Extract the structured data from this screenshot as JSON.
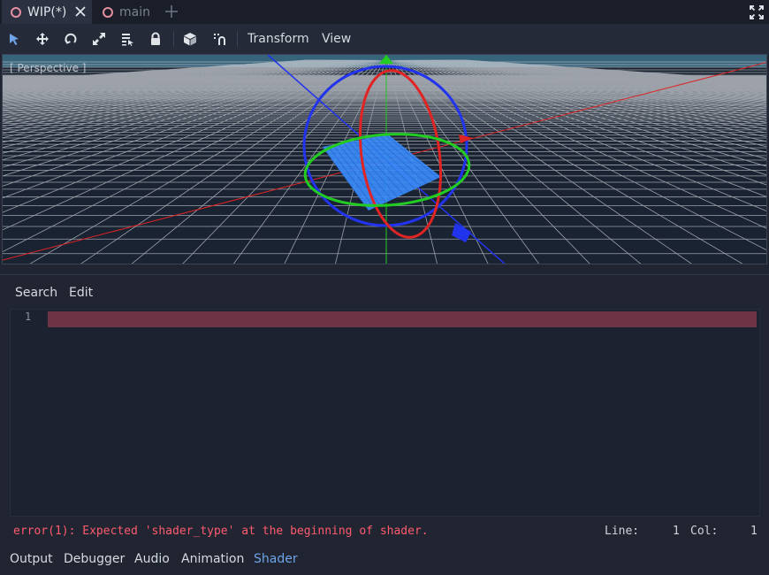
{
  "scene_tabs": {
    "tabs": [
      {
        "label": "WIP(*)",
        "icon": "scene-node-icon",
        "active": true
      },
      {
        "label": "main",
        "icon": "scene-node-icon",
        "active": false
      }
    ],
    "add_icon": "plus-icon",
    "close_icon": "close-icon",
    "distraction_icon": "fullscreen-icon"
  },
  "toolbar": {
    "tools": [
      "select-icon",
      "move-icon",
      "rotate-icon",
      "scale-icon",
      "list-select-icon",
      "lock-icon",
      "local-space-icon",
      "snap-icon"
    ],
    "transform_label": "Transform",
    "view_label": "View"
  },
  "viewport": {
    "label": "[ Perspective ]",
    "colors": {
      "bg": "#1a2332",
      "grid": "#c8ccd2",
      "x_axis": "#e02424",
      "y_axis": "#22cc22",
      "z_axis": "#2233ee",
      "plane": "#3a8dfc"
    }
  },
  "shader_editor": {
    "menu": [
      "Search",
      "Edit"
    ],
    "line_numbers": [
      "1"
    ],
    "error_message": "error(1): Expected 'shader_type' at the beginning of shader.",
    "status": {
      "line_label": "Line:",
      "line_value": "1",
      "col_label": "Col:",
      "col_value": "1"
    }
  },
  "bottom_panel": {
    "tabs": [
      "Output",
      "Debugger",
      "Audio",
      "Animation",
      "Shader"
    ],
    "active_tab": "Shader"
  }
}
